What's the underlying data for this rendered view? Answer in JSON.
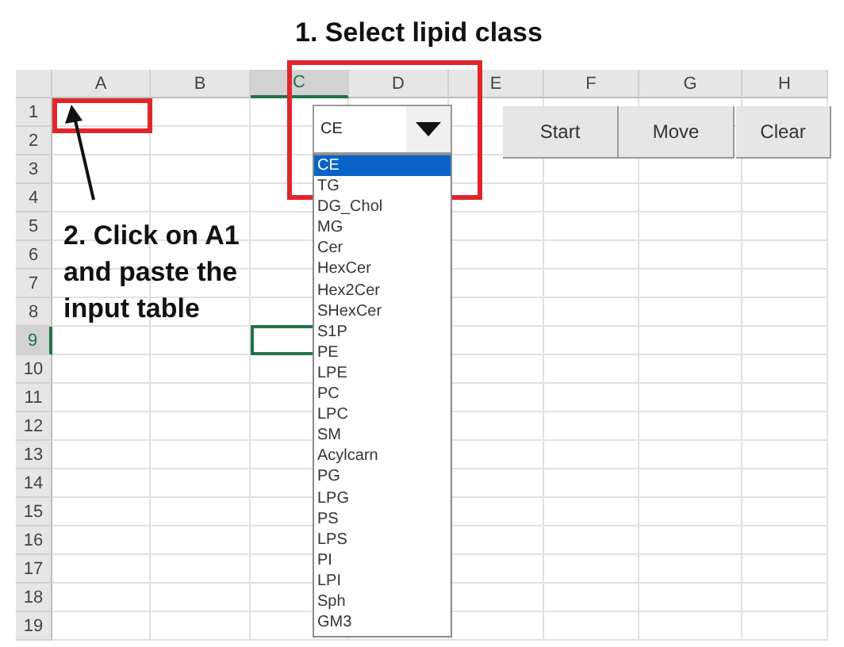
{
  "title": "1. Select lipid class",
  "columns": [
    {
      "label": "A",
      "selected": false
    },
    {
      "label": "B",
      "selected": false
    },
    {
      "label": "C",
      "selected": true
    },
    {
      "label": "D",
      "selected": false
    },
    {
      "label": "E",
      "selected": false
    },
    {
      "label": "F",
      "selected": false
    },
    {
      "label": "G",
      "selected": false
    },
    {
      "label": "H",
      "selected": false
    }
  ],
  "rows": [
    {
      "label": "1",
      "selected": false
    },
    {
      "label": "2",
      "selected": false
    },
    {
      "label": "3",
      "selected": false
    },
    {
      "label": "4",
      "selected": false
    },
    {
      "label": "5",
      "selected": false
    },
    {
      "label": "6",
      "selected": false
    },
    {
      "label": "7",
      "selected": false
    },
    {
      "label": "8",
      "selected": false
    },
    {
      "label": "9",
      "selected": true
    },
    {
      "label": "10",
      "selected": false
    },
    {
      "label": "11",
      "selected": false
    },
    {
      "label": "12",
      "selected": false
    },
    {
      "label": "13",
      "selected": false
    },
    {
      "label": "14",
      "selected": false
    },
    {
      "label": "15",
      "selected": false
    },
    {
      "label": "16",
      "selected": false
    },
    {
      "label": "17",
      "selected": false
    },
    {
      "label": "18",
      "selected": false
    },
    {
      "label": "19",
      "selected": false
    }
  ],
  "combo": {
    "value": "CE",
    "options": [
      {
        "label": "CE",
        "selected": true
      },
      {
        "label": "TG",
        "selected": false
      },
      {
        "label": "DG_Chol",
        "selected": false
      },
      {
        "label": "MG",
        "selected": false
      },
      {
        "label": "Cer",
        "selected": false
      },
      {
        "label": "HexCer",
        "selected": false
      },
      {
        "label": "Hex2Cer",
        "selected": false
      },
      {
        "label": "SHexCer",
        "selected": false
      },
      {
        "label": "S1P",
        "selected": false
      },
      {
        "label": "PE",
        "selected": false
      },
      {
        "label": "LPE",
        "selected": false
      },
      {
        "label": "PC",
        "selected": false
      },
      {
        "label": "LPC",
        "selected": false
      },
      {
        "label": "SM",
        "selected": false
      },
      {
        "label": "Acylcarn",
        "selected": false
      },
      {
        "label": "PG",
        "selected": false
      },
      {
        "label": "LPG",
        "selected": false
      },
      {
        "label": "PS",
        "selected": false
      },
      {
        "label": "LPS",
        "selected": false
      },
      {
        "label": "PI",
        "selected": false
      },
      {
        "label": "LPI",
        "selected": false
      },
      {
        "label": "Sph",
        "selected": false
      },
      {
        "label": "GM3",
        "selected": false
      }
    ]
  },
  "buttons": [
    "Start",
    "Move",
    "Clear"
  ],
  "instruction": "2. Click on A1 and paste the input table"
}
